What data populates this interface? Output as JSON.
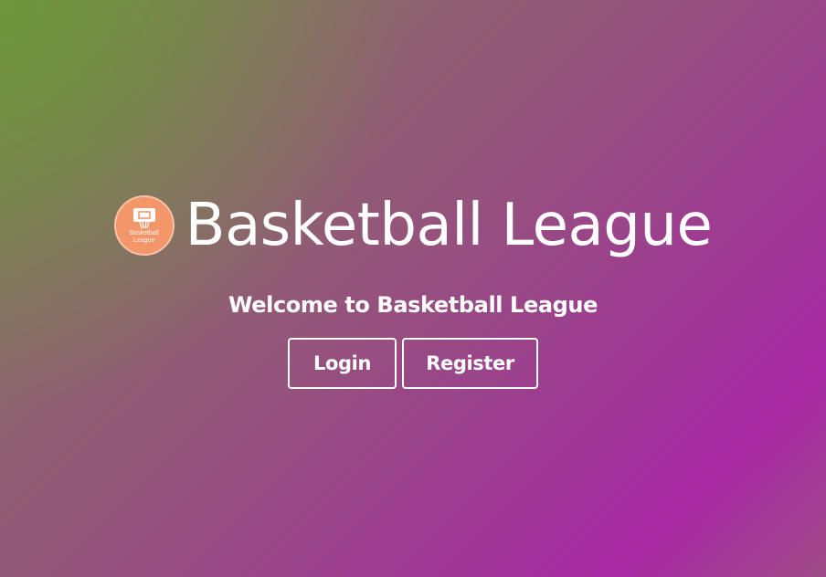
{
  "header": {
    "logo": {
      "line1": "Basketball",
      "line2": "League",
      "icon": "basketball-hoop-icon",
      "color": "#f3966a"
    },
    "title": "Basketball League"
  },
  "main": {
    "welcome": "Welcome to Basketball League",
    "buttons": {
      "login_label": "Login",
      "register_label": "Register"
    }
  },
  "colors": {
    "gradient_start": "#6e963c",
    "gradient_mid": "#94557a",
    "gradient_end": "#a82aa5",
    "text": "#ffffff"
  }
}
